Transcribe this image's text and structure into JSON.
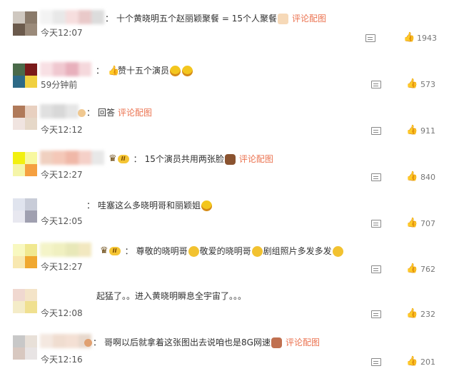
{
  "comments": [
    {
      "text": "十个黄晓明五个赵丽颖聚餐 = 15个人聚餐",
      "link": "评论配图",
      "time": "今天12:07",
      "likes": "1943",
      "avatar": [
        "#cfc8c0",
        "#8a7a6a",
        "#6b5a4c",
        "#9a8a7a"
      ],
      "name_colors": [
        "#f3f3f3",
        "#e8e8e8",
        "#f6dede",
        "#e9c9c9",
        "#dcdcdc"
      ]
    },
    {
      "text": "赞十五个演员",
      "link": "",
      "time": "59分钟前",
      "likes": "573",
      "avatar": [
        "#4a6a4a",
        "#7a1a1a",
        "#2d6a86",
        "#f0d040"
      ],
      "name_colors": [
        "#f8e0e4",
        "#f0c8d0",
        "#e8b0bc",
        "#f5d8dc"
      ]
    },
    {
      "text": "回答",
      "link": "评论配图",
      "time": "今天12:12",
      "likes": "911",
      "avatar": [
        "#b07a5a",
        "#e8d0c0",
        "#f0e4e0",
        "#e6d8c8"
      ],
      "name_colors": [
        "#e0e0e0",
        "#d8d8d8",
        "#e6e6e6"
      ]
    },
    {
      "text": "15个演员共用两张脸",
      "link": "评论配图",
      "time": "今天12:27",
      "likes": "840",
      "avatar": [
        "#f2f010",
        "#f8f8a0",
        "#f5f5a8",
        "#f5a040"
      ],
      "name_colors": [
        "#f0d0c0",
        "#f4c8b8",
        "#f0b8a8",
        "#f5d0c8",
        "#e8e8e8"
      ]
    },
    {
      "text": "哇塞这么多晓明哥和丽颖姐",
      "link": "",
      "time": "今天12:05",
      "likes": "707",
      "avatar": [
        "#e0e4ee",
        "#c8ccd8",
        "#e8e8f0",
        "#a0a0b0"
      ],
      "name_colors": []
    },
    {
      "text_parts": [
        "尊敬的晓明哥",
        "敬爱的晓明哥",
        "剧组照片多发多发"
      ],
      "link": "",
      "time": "今天12:27",
      "likes": "762",
      "avatar": [
        "#f8f8c0",
        "#f0e890",
        "#f8e8b0",
        "#f0a830"
      ],
      "name_colors": [
        "#f4f4c8",
        "#f0f0c0",
        "#e8e8b8",
        "#f2e8c0"
      ]
    },
    {
      "text": "起猛了。。进入黄晓明瞬息全宇宙了。。。",
      "link": "",
      "time": "今天12:08",
      "likes": "232",
      "avatar": [
        "#f0d8d0",
        "#f4e4c8",
        "#f4ecc8",
        "#f0e090"
      ],
      "name_colors": []
    },
    {
      "text": "哥啊以后就拿着这张图出去说咱也是8G网速",
      "link": "评论配图",
      "time": "今天12:16",
      "likes": "201",
      "avatar": [
        "#c8c8c8",
        "#e8e0d8",
        "#d8c8c0",
        "#e8e4e4"
      ],
      "name_colors": [
        "#f4e8e0",
        "#f0ddd0",
        "#f4e0d4",
        "#e8d8cc"
      ]
    }
  ],
  "badge_level": "II",
  "colors": {
    "link": "#eb7350",
    "time": "#555555",
    "count": "#777777"
  },
  "icons": [
    "share-icon",
    "like-icon",
    "crown-icon",
    "emoji-icon"
  ]
}
